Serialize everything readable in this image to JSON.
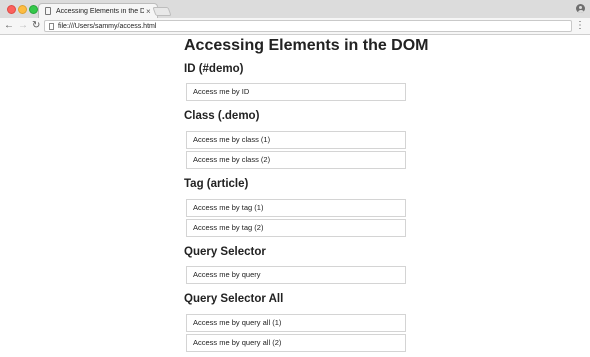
{
  "browser": {
    "tab_title": "Accessing Elements in the DOM",
    "address": "file:///Users/sammy/access.html"
  },
  "page": {
    "title": "Accessing Elements in the DOM",
    "sections": [
      {
        "heading": "ID (#demo)",
        "items": [
          "Access me by ID"
        ]
      },
      {
        "heading": "Class (.demo)",
        "items": [
          "Access me by class (1)",
          "Access me by class (2)"
        ]
      },
      {
        "heading": "Tag (article)",
        "items": [
          "Access me by tag (1)",
          "Access me by tag (2)"
        ]
      },
      {
        "heading": "Query Selector",
        "items": [
          "Access me by query"
        ]
      },
      {
        "heading": "Query Selector All",
        "items": [
          "Access me by query all (1)",
          "Access me by query all (2)"
        ]
      }
    ]
  }
}
